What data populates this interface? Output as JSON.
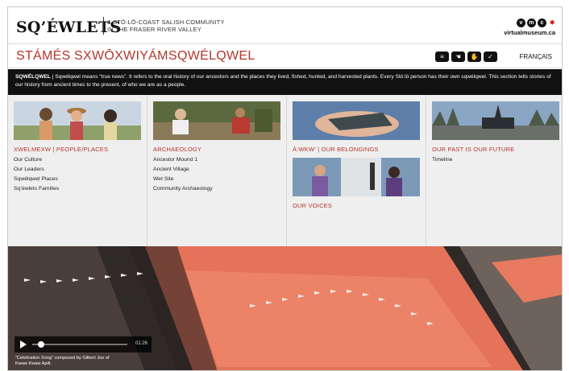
{
  "header": {
    "brand": "SQ’ÉWLETS",
    "tagline_line1": "A STÓ:LŌ-COAST SALISH COMMUNITY",
    "tagline_line2": "IN THE FRASER RIVER VALLEY",
    "site": "virtualmuseum.ca"
  },
  "nav": {
    "items": [
      "STÁMÉS",
      "SXWŌXWIYÁM",
      "SQWÉLQWEL"
    ],
    "language": "FRANÇAIS",
    "tool_icons": [
      "text-icon",
      "hand-sign-icon",
      "hand-icon",
      "check-icon"
    ]
  },
  "intro": {
    "term": "SQWÉLQWEL",
    "text": " | Sqwélqwel means “true news”. It refers to the oral history of our ancestors and the places they lived, fished, hunted, and harvested plants. Every Stó:lō person has their own sqwélqwel. This section tells stories of our history from ancient times to the present, of who we are as a people."
  },
  "columns": [
    {
      "title": "XWELMEXW | PEOPLE/PLACES",
      "links": [
        "Our Culture",
        "Our Leaders",
        "Sqwélqwel Places",
        "Sq’éwlets Families"
      ]
    },
    {
      "title": "ARCHAEOLOGY",
      "links": [
        "Ancestor Mound 1",
        "Ancient Village",
        "Wet Site",
        "Community Archaeology"
      ]
    },
    {
      "title": "Á:WKW’ | OUR BELONGINGS",
      "title2": "OUR VOICES",
      "links": []
    },
    {
      "title": "OUR PAST IS OUR FUTURE",
      "links": [
        "Timeline"
      ]
    }
  ],
  "player": {
    "time": "01:26",
    "progress": 0.06,
    "caption_line1": "“Celebration Song” composed by Gilbert Joe of",
    "caption_line2": "Kwaw Kwaw Apilt."
  },
  "colors": {
    "accent": "#b3362b",
    "band": "#111111",
    "panel": "#efefef"
  }
}
